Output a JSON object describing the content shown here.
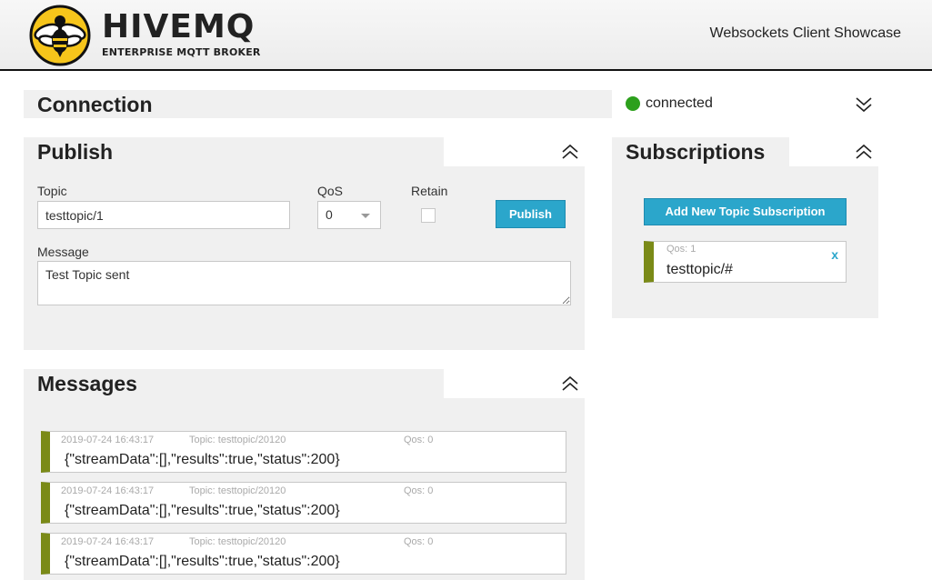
{
  "header": {
    "brand_name": "HIVEMQ",
    "brand_tagline": "ENTERPRISE MQTT BROKER",
    "app_title": "Websockets Client Showcase"
  },
  "connection": {
    "title": "Connection",
    "status": "connected",
    "status_color": "#2ca01c",
    "toggle_icon": "chevron-double-down"
  },
  "publish": {
    "title": "Publish",
    "toggle_icon": "chevron-double-up",
    "topic_label": "Topic",
    "topic_value": "testtopic/1",
    "qos_label": "QoS",
    "qos_value": "0",
    "retain_label": "Retain",
    "retain_checked": false,
    "publish_button": "Publish",
    "message_label": "Message",
    "message_value": "Test Topic sent"
  },
  "subscriptions": {
    "title": "Subscriptions",
    "toggle_icon": "chevron-double-up",
    "add_button": "Add New Topic Subscription",
    "items": [
      {
        "qos": "Qos: 1",
        "topic": "testtopic/#",
        "color": "#7a8a17",
        "remove_label": "x"
      }
    ]
  },
  "messages": {
    "title": "Messages",
    "toggle_icon": "chevron-double-up",
    "items": [
      {
        "date": "2019-07-24 16:43:17",
        "topic": "Topic: testtopic/20120",
        "qos": "Qos: 0",
        "payload": "{\"streamData\":[],\"results\":true,\"status\":200}"
      },
      {
        "date": "2019-07-24 16:43:17",
        "topic": "Topic: testtopic/20120",
        "qos": "Qos: 0",
        "payload": "{\"streamData\":[],\"results\":true,\"status\":200}"
      },
      {
        "date": "2019-07-24 16:43:17",
        "topic": "Topic: testtopic/20120",
        "qos": "Qos: 0",
        "payload": "{\"streamData\":[],\"results\":true,\"status\":200}"
      }
    ]
  },
  "colors": {
    "accent": "#2ba6cb",
    "panel_bg": "#f0f0f0",
    "item_stripe": "#7a8a17",
    "logo_yellow": "#f6c51b"
  }
}
